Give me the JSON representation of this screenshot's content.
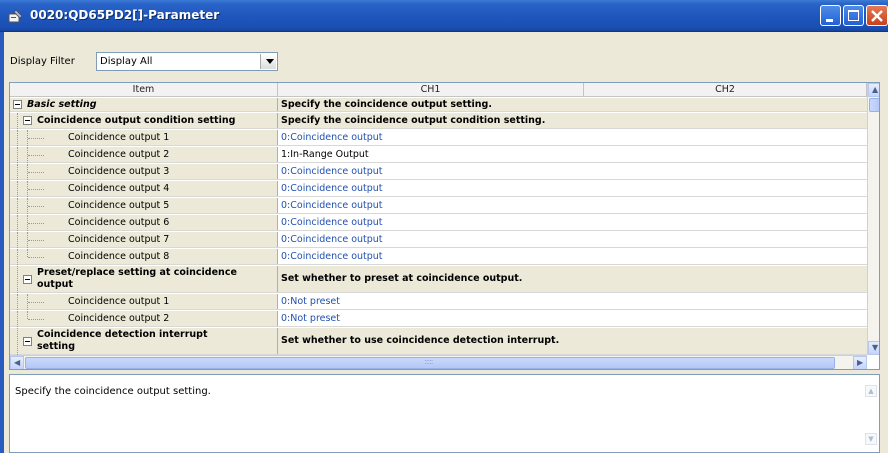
{
  "window": {
    "title": "0020:QD65PD2[]-Parameter",
    "title_color": "#1f57be",
    "close_color": "#c8401d"
  },
  "filter": {
    "label": "Display Filter",
    "selected": "Display All"
  },
  "grid": {
    "headers": {
      "item": "Item",
      "ch1": "CH1",
      "ch2": "CH2"
    },
    "rows": [
      {
        "item": "Basic setting",
        "ch1": "Specify the coincidence output setting."
      },
      {
        "item": "Coincidence output condition setting",
        "ch1": "Specify the coincidence output condition setting."
      },
      {
        "item": "Coincidence output 1",
        "ch1": "0:Coincidence output"
      },
      {
        "item": "Coincidence output 2",
        "ch1": "1:In-Range Output"
      },
      {
        "item": "Coincidence output 3",
        "ch1": "0:Coincidence output"
      },
      {
        "item": "Coincidence output 4",
        "ch1": "0:Coincidence output"
      },
      {
        "item": "Coincidence output 5",
        "ch1": "0:Coincidence output"
      },
      {
        "item": "Coincidence output 6",
        "ch1": "0:Coincidence output"
      },
      {
        "item": "Coincidence output 7",
        "ch1": "0:Coincidence output"
      },
      {
        "item": "Coincidence output 8",
        "ch1": "0:Coincidence output"
      },
      {
        "item_line1": "Preset/replace setting at coincidence",
        "item_line2": "output",
        "ch1": "Set whether to preset at coincidence output."
      },
      {
        "item": "Coincidence output 1",
        "ch1": "0:Not preset"
      },
      {
        "item": "Coincidence output 2",
        "ch1": "0:Not preset"
      },
      {
        "item_line1": "Coincidence detection interrupt",
        "item_line2": "setting",
        "ch1": "Set whether to use coincidence detection interrupt."
      }
    ]
  },
  "description": {
    "text": "Specify the coincidence output setting."
  }
}
